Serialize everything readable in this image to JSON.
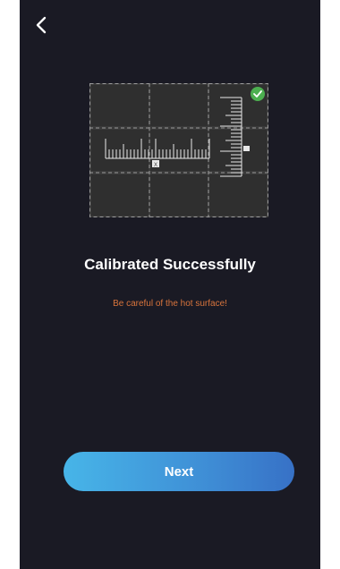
{
  "screen": {
    "title": "Calibrated Successfully",
    "warning": "Be careful of the hot surface!"
  },
  "actions": {
    "next_label": "Next"
  },
  "illustration": {
    "horizontal_marker": "X",
    "status": "check-icon"
  },
  "colors": {
    "background": "#1a1a24",
    "accent_start": "#47b5e8",
    "accent_end": "#3771c6",
    "warning": "#d8743c",
    "success": "#4caf50"
  }
}
